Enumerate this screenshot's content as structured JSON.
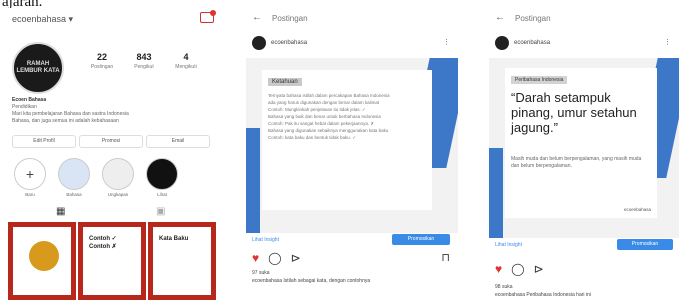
{
  "caption": "ajarah.",
  "profile": {
    "username": "ecoenbahasa ▾",
    "avatar_text": "RAMAH LEMBUR KATA",
    "stats": [
      {
        "num": "22",
        "label": "Postingan"
      },
      {
        "num": "843",
        "label": "Pengikut"
      },
      {
        "num": "4",
        "label": "Mengikuti"
      }
    ],
    "bio_name": "Ecoen Bahasa",
    "bio_cat": "Pendidikan",
    "bio_lines": [
      "Mari kita pembelajaran Bahasa dan sastra Indonesia",
      "Bahasa, dan juga semua ini adalah kebahasaan"
    ],
    "buttons": [
      "Edit Profil",
      "Promosi",
      "Email"
    ],
    "highlights": [
      "Baru",
      "Bahasa",
      "Ungkapan",
      "Lihat"
    ]
  },
  "post1": {
    "title": "Postingan",
    "account": "ecoenbahasa",
    "slide_title": "Ketahuan",
    "slide_lines": [
      "Ternyata bahasa istilah dalam percakapan Bahasa Indonesia",
      "ada yang harus digunakan dengan benar dalam kalimat",
      "Contoh: Mungkinkah penjelasan itu tidak jelas. ✓",
      "Bahasa yang baik dan benar untuk berbahasa Indonesia",
      "Contoh: Pak itu sangat hebat dalam pekerjaannya. ✗",
      "Bahasa yang digunakan sebaiknya menggunakan kata baku",
      "Contoh: kata baku dan bentuk tidak baku. ✓"
    ],
    "cta": "Promosikan",
    "promo": "Lihat Insight",
    "likes": "97 suka",
    "caption": "ecoenbahasa Istilah sebagai kata, dengan contohnya"
  },
  "post2": {
    "title": "Postingan",
    "account": "ecoenbahasa",
    "label": "Peribahasa Indonesia",
    "quote": "“Darah setampuk pinang, umur setahun jagung.”",
    "meaning": "Masih muda dan belum berpengalaman, yang masih muda dan belum berpengalaman.",
    "logo": "ecoenbahasa",
    "cta": "Promosikan",
    "promo": "Lihat Insight",
    "likes": "98 suka",
    "caption": "ecoenbahasa Peribahasa Indonesia hari ini"
  }
}
